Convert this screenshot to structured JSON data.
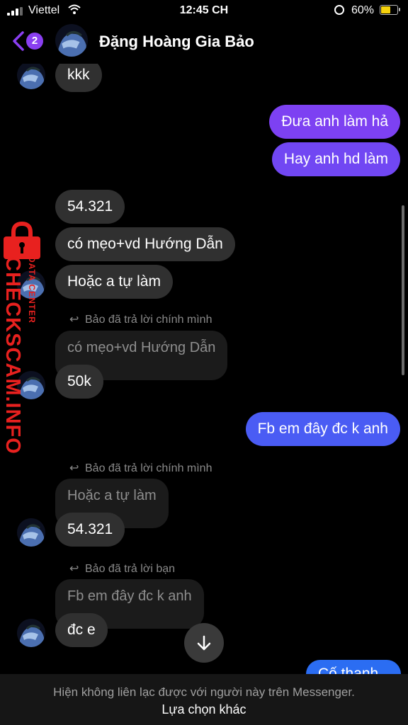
{
  "status_bar": {
    "carrier": "Viettel",
    "time": "12:45 CH",
    "battery_percent": "60%",
    "battery_level": 0.6
  },
  "header": {
    "back_badge_count": "2",
    "contact_name": "Đặng Hoàng Gia Bảo"
  },
  "watermark": {
    "site": "CHECKSCAM.INFO",
    "tagline": "DATA CENTER"
  },
  "messages": [
    {
      "side": "in",
      "text": "kkk"
    },
    {
      "side": "out",
      "text": "Đưa anh làm hả"
    },
    {
      "side": "out",
      "text": "Hay anh hd làm"
    },
    {
      "side": "in",
      "text": "54.321"
    },
    {
      "side": "in",
      "text": "có mẹo+vd Hướng Dẫn"
    },
    {
      "side": "in",
      "text": "Hoặc a tự làm"
    },
    {
      "side": "in",
      "reply_label": "Bảo đã trả lời chính mình",
      "quoted": "có mẹo+vd Hướng Dẫn",
      "text": "50k"
    },
    {
      "side": "out",
      "text": "Fb em đây đc k anh"
    },
    {
      "side": "in",
      "reply_label": "Bảo đã trả lời chính mình",
      "quoted": "Hoặc a tự làm",
      "text": "54.321"
    },
    {
      "side": "in",
      "reply_label": "Bảo đã trả lời bạn",
      "quoted": "Fb em đây đc k anh",
      "text": "đc e"
    },
    {
      "side": "out",
      "text": "Cố thanh"
    }
  ],
  "footer": {
    "notice": "Hiện không liên lạc được với người này trên Messenger.",
    "action": "Lựa chọn khác"
  },
  "colors": {
    "outgoing_gradient": [
      "#8a3ff1",
      "#5a4ff3",
      "#2f6af5"
    ],
    "incoming": "#303030",
    "watermark": "#e8211f"
  }
}
